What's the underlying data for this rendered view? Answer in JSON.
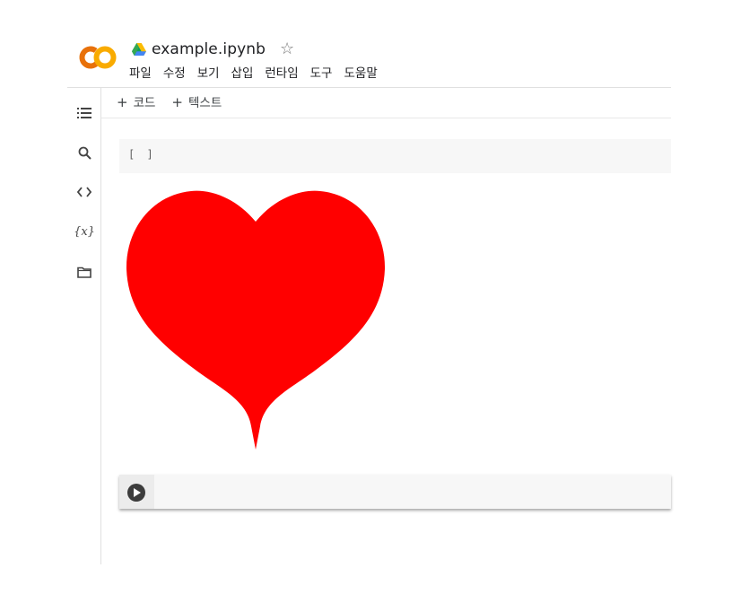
{
  "app": {
    "logo_text": "CO",
    "notebook_title": "example.ipynb",
    "star": "☆"
  },
  "menu": [
    "파일",
    "수정",
    "보기",
    "삽입",
    "런타임",
    "도구",
    "도움말"
  ],
  "toolbar": {
    "add_code": "코드",
    "add_text": "텍스트",
    "plus": "+"
  },
  "cells": [
    {
      "execution_count": "[ ]",
      "output": "heart"
    },
    {
      "execution_count": ""
    }
  ],
  "colors": {
    "heart": "#ff0000",
    "logo_orange": "#f9ab00",
    "logo_dark_orange": "#e8710a"
  },
  "sidebar": {
    "icons": [
      "table-of-contents-icon",
      "search-icon",
      "code-snippets-icon",
      "variables-icon",
      "files-icon"
    ],
    "variables_glyph": "{x}"
  }
}
